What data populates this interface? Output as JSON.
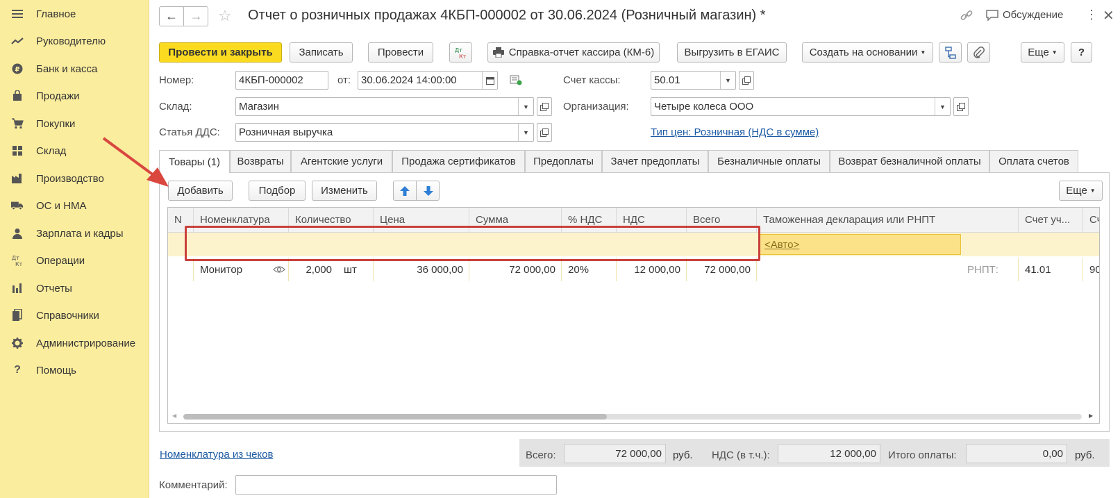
{
  "sidebar": {
    "items": [
      {
        "label": "Главное",
        "icon": "menu-icon"
      },
      {
        "label": "Руководителю",
        "icon": "trend-icon"
      },
      {
        "label": "Банк и касса",
        "icon": "coin-icon"
      },
      {
        "label": "Продажи",
        "icon": "bag-icon"
      },
      {
        "label": "Покупки",
        "icon": "cart-icon"
      },
      {
        "label": "Склад",
        "icon": "warehouse-icon"
      },
      {
        "label": "Производство",
        "icon": "factory-icon"
      },
      {
        "label": "ОС и НМА",
        "icon": "truck-icon"
      },
      {
        "label": "Зарплата и кадры",
        "icon": "person-icon"
      },
      {
        "label": "Операции",
        "icon": "dtkt-icon"
      },
      {
        "label": "Отчеты",
        "icon": "bars-icon"
      },
      {
        "label": "Справочники",
        "icon": "books-icon"
      },
      {
        "label": "Администрирование",
        "icon": "gear-icon"
      },
      {
        "label": "Помощь",
        "icon": "help-icon"
      }
    ]
  },
  "header": {
    "title": "Отчет о розничных продажах 4КБП-000002 от 30.06.2024 (Розничный магазин) *",
    "discussion": "Обсуждение"
  },
  "toolbar": {
    "post_close": "Провести и закрыть",
    "save": "Записать",
    "post": "Провести",
    "dtkt": "Дт Кт",
    "km6": "Справка-отчет кассира (КМ-6)",
    "egais": "Выгрузить в ЕГАИС",
    "create_based": "Создать на основании",
    "more": "Еще",
    "help": "?"
  },
  "form": {
    "number_label": "Номер:",
    "number": "4КБП-000002",
    "date_label": "от:",
    "date": "30.06.2024 14:00:00",
    "cash_account_label": "Счет кассы:",
    "cash_account": "50.01",
    "warehouse_label": "Склад:",
    "warehouse": "Магазин",
    "org_label": "Организация:",
    "org": "Четыре колеса ООО",
    "dds_label": "Статья ДДС:",
    "dds": "Розничная выручка",
    "price_type_link": "Тип цен: Розничная (НДС в сумме)"
  },
  "tabs": [
    "Товары (1)",
    "Возвраты",
    "Агентские услуги",
    "Продажа сертификатов",
    "Предоплаты",
    "Зачет предоплаты",
    "Безналичные оплаты",
    "Возврат безналичной оплаты",
    "Оплата счетов"
  ],
  "table_toolbar": {
    "add": "Добавить",
    "select": "Подбор",
    "change": "Изменить",
    "more": "Еще"
  },
  "table": {
    "columns": [
      "N",
      "Номенклатура",
      "Количество",
      "Цена",
      "Сумма",
      "% НДС",
      "НДС",
      "Всего",
      "Таможенная декларация или РНПТ",
      "Счет уч...",
      "Сч"
    ],
    "rows": [
      {
        "item": "Монитор",
        "qty": "2,000",
        "unit": "шт",
        "price": "36 000,00",
        "sum": "72 000,00",
        "vat_rate": "20%",
        "vat": "12 000,00",
        "total": "72 000,00",
        "customs": "<Авто>",
        "rnpt": "РНПТ:",
        "account": "41.01",
        "account2": "90"
      }
    ]
  },
  "footer": {
    "checks_link": "Номенклатура из чеков",
    "total_label": "Всего:",
    "total": "72 000,00",
    "currency": "руб.",
    "vat_label": "НДС (в т.ч.):",
    "vat": "12 000,00",
    "paid_label": "Итого оплаты:",
    "paid": "0,00",
    "currency2": "руб.",
    "comment_label": "Комментарий:",
    "comment": ""
  },
  "colors": {
    "sidebar_bg": "#fbed9e",
    "primary_button": "#fadb1f",
    "selected_row": "#fcf3cc",
    "highlight_border": "#c9403a",
    "link": "#1c5aa3"
  }
}
